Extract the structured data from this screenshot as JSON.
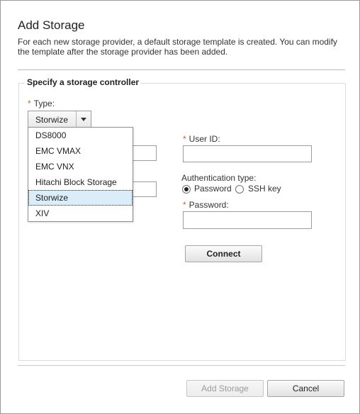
{
  "dialog": {
    "title": "Add Storage",
    "description": "For each new storage provider, a default storage template is created. You can modify the template after the storage provider has been added."
  },
  "section": {
    "legend": "Specify a storage controller"
  },
  "form": {
    "required_marker": "*",
    "type_label": "Type:",
    "type_value": "Storwize",
    "type_options": [
      "DS8000",
      "EMC VMAX",
      "EMC VNX",
      "Hitachi Block Storage",
      "Storwize",
      "XIV"
    ],
    "user_id_label": "User ID:",
    "user_id_value": "",
    "auth_type_label": "Authentication type:",
    "auth_options": [
      {
        "label": "Password",
        "checked": true
      },
      {
        "label": "SSH key",
        "checked": false
      }
    ],
    "password_label": "Password:",
    "password_value": "",
    "connect_label": "Connect"
  },
  "footer": {
    "add_storage_label": "Add Storage",
    "cancel_label": "Cancel"
  },
  "colors": {
    "required": "#d65d2b",
    "selected_item_bg": "#dbedf8"
  },
  "icons": {
    "dropdown": "chevron-down-icon"
  }
}
